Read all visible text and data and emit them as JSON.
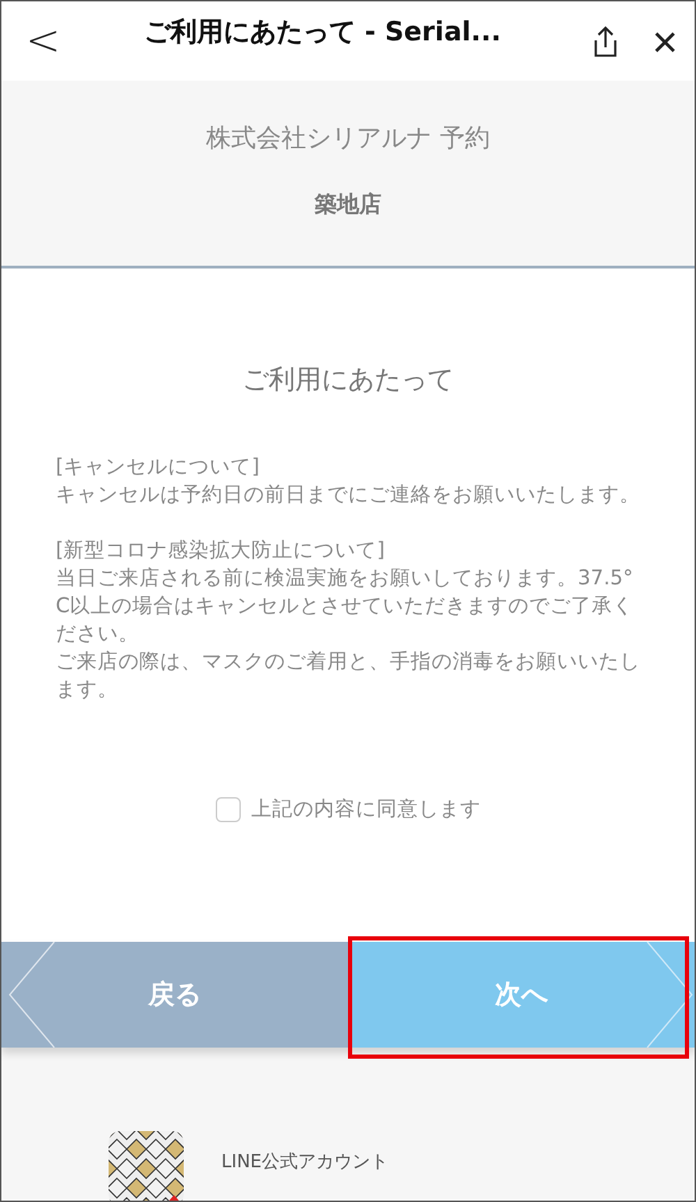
{
  "nav_bar": {
    "back": "<",
    "title": "ご利用にあたって - Serial...",
    "close": "×"
  },
  "header": {
    "company": "株式会社シリアルナ 予約",
    "store": "築地店"
  },
  "content": {
    "heading": "ご利用にあたって",
    "sections": [
      {
        "paragraphs": [
          "[キャンセルについて]",
          "キャンセルは予約日の前日までにご連絡をお願いいたします。"
        ]
      },
      {
        "paragraphs": [
          "[新型コロナ感染拡大防止について]",
          "当日ご来店される前に検温実施をお願いしております。37.5°C以上の場合はキャンセルとさせていただきますのでご了承ください。",
          "ご来店の際は、マスクのご着用と、手指の消毒をお願いいたします。"
        ]
      }
    ],
    "agreement": {
      "label": "上記の内容に同意します",
      "checked": false
    }
  },
  "buttons": [
    {
      "kind": "back",
      "label": "戻る",
      "highlighted": false
    },
    {
      "kind": "next",
      "label": "次へ",
      "highlighted": true
    }
  ],
  "footer": {
    "account_label": "LINE公式アカウント"
  }
}
